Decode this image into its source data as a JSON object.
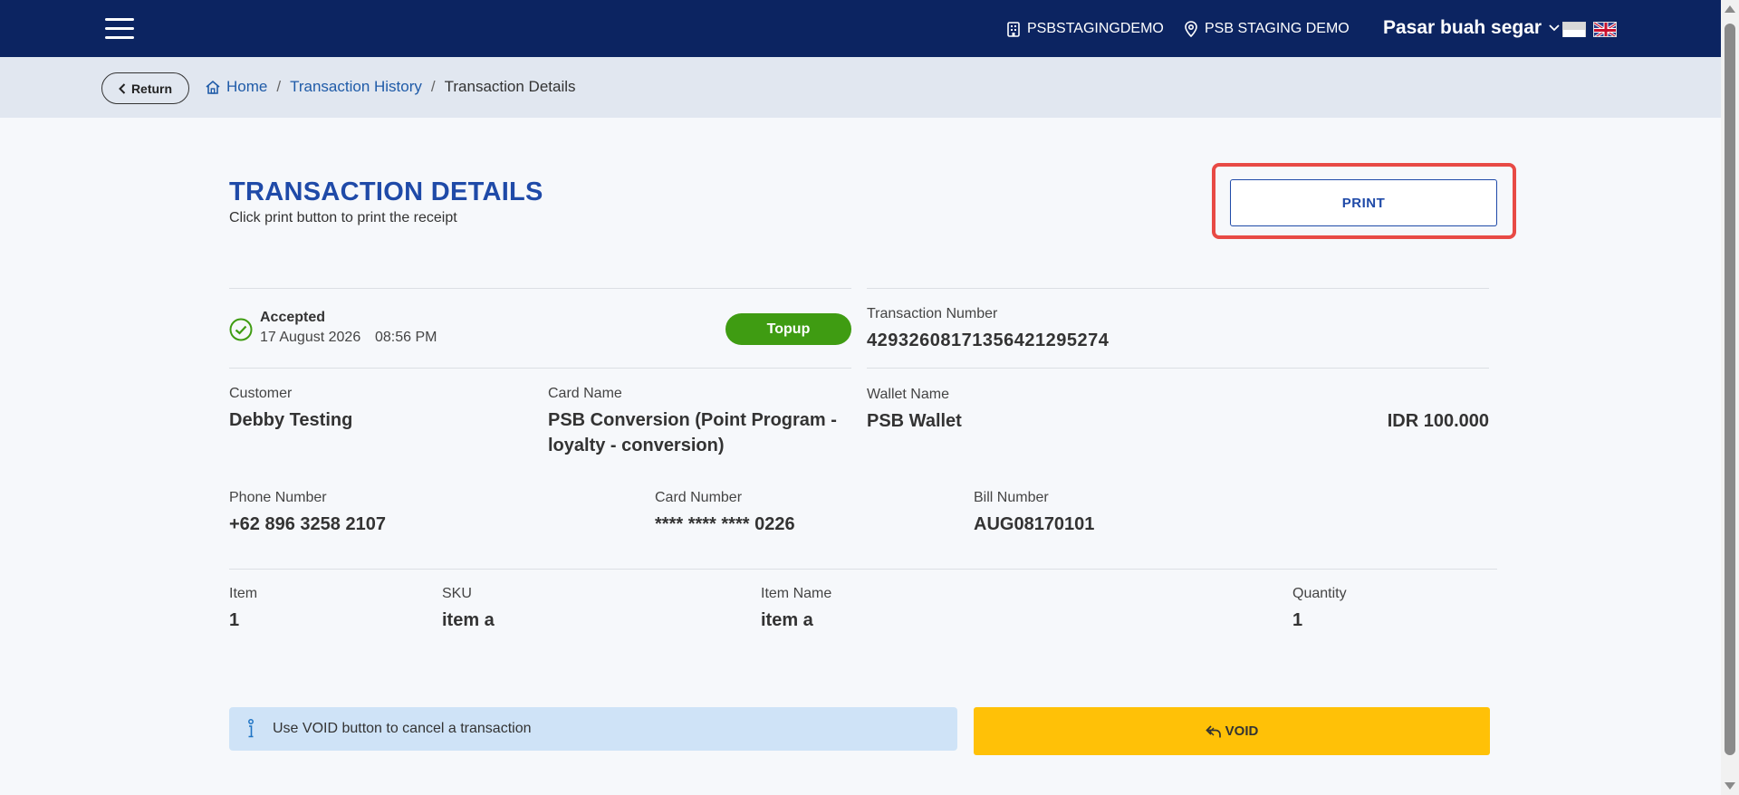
{
  "topbar": {
    "store_code": "PSBSTAGINGDEMO",
    "location": "PSB STAGING DEMO",
    "merchant": "Pasar buah segar",
    "bg_color": "#0c2461"
  },
  "breadcrumb": {
    "return_label": "Return",
    "items": [
      "Home",
      "Transaction History",
      "Transaction Details"
    ],
    "separator": "/"
  },
  "header": {
    "title": "TRANSACTION DETAILS",
    "subtitle": "Click print button to print the receipt",
    "print_label": "PRINT"
  },
  "status": {
    "label": "Accepted",
    "date": "17 August 2026",
    "time": "08:56 PM",
    "type": "Topup",
    "type_color": "#3f9c12"
  },
  "transaction": {
    "number_label": "Transaction Number",
    "number": "4293260817135642129527​4"
  },
  "customer": {
    "customer_label": "Customer",
    "customer": "Debby Testing",
    "card_name_label": "Card Name",
    "card_name_line1": "PSB Conversion (Point Program -",
    "card_name_line2": "loyalty - conversion)",
    "wallet_label": "Wallet Name",
    "wallet": "PSB Wallet",
    "amount": "IDR 100.000",
    "phone_label": "Phone Number",
    "phone": "+62 896 3258 2107",
    "card_number_label": "Card Number",
    "card_number": "**** **** **** 0226",
    "bill_label": "Bill Number",
    "bill": "AUG08170101"
  },
  "items_table": {
    "headers": [
      "Item",
      "SKU",
      "Item Name",
      "Quantity"
    ],
    "rows": [
      [
        "1",
        "item a",
        "item a",
        "1"
      ]
    ]
  },
  "footer": {
    "info_text": "Use VOID button to cancel a transaction",
    "void_label": "VOID",
    "void_color": "#ffc107",
    "info_color": "#cfe3f7"
  },
  "highlight_color": "#e84a45"
}
